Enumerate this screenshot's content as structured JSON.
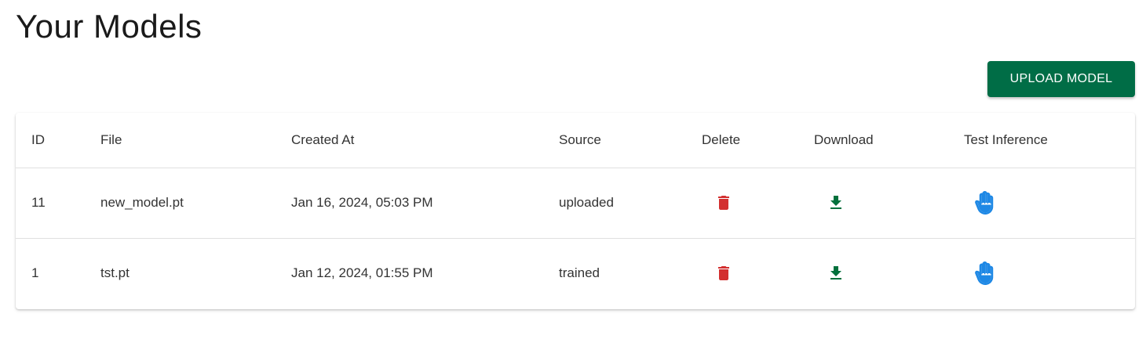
{
  "header": {
    "title": "Your Models"
  },
  "toolbar": {
    "upload_label": "UPLOAD MODEL"
  },
  "table": {
    "columns": {
      "id": "ID",
      "file": "File",
      "created_at": "Created At",
      "source": "Source",
      "delete": "Delete",
      "download": "Download",
      "test_inference": "Test Inference"
    },
    "rows": [
      {
        "id": "11",
        "file": "new_model.pt",
        "created_at": "Jan 16, 2024, 05:03 PM",
        "source": "uploaded"
      },
      {
        "id": "1",
        "file": "tst.pt",
        "created_at": "Jan 12, 2024, 01:55 PM",
        "source": "trained"
      }
    ]
  },
  "icons": {
    "delete": "trash-icon",
    "download": "download-icon",
    "test_inference": "hand-icon"
  },
  "colors": {
    "primary_button": "#006d46",
    "delete_icon": "#d32f2f",
    "download_icon": "#00703c",
    "inference_icon": "#1e88e5"
  }
}
